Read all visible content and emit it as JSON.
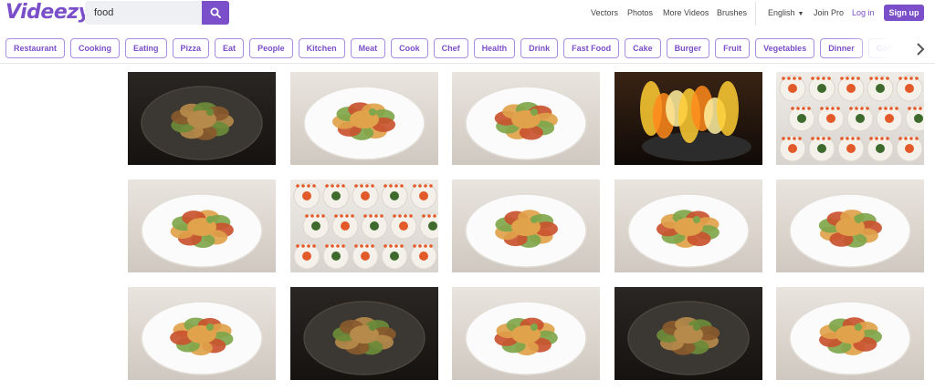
{
  "brand": {
    "logo": "Videezy",
    "accent": "#7a4fc9"
  },
  "search": {
    "value": "food",
    "icon": "search-icon"
  },
  "nav": {
    "vectors": "Vectors",
    "photos": "Photos",
    "more_videos": "More Videos",
    "brushes": "Brushes"
  },
  "account": {
    "language": "English",
    "join_pro": "Join Pro",
    "login": "Log in",
    "signup": "Sign up"
  },
  "tags": [
    "Restaurant",
    "Cooking",
    "Eating",
    "Pizza",
    "Eat",
    "People",
    "Kitchen",
    "Meat",
    "Cook",
    "Chef",
    "Health",
    "Drink",
    "Fast Food",
    "Cake",
    "Burger",
    "Fruit",
    "Vegetables",
    "Dinner",
    "Coffee"
  ],
  "tag_next_icon": "chevron-right-icon",
  "results": [
    {
      "subject": "noodles-wok",
      "scene": "dark"
    },
    {
      "subject": "vegetable-dip-platter",
      "scene": "plate"
    },
    {
      "subject": "grilled-shrimp-sauce",
      "scene": "plate"
    },
    {
      "subject": "flaming-wok",
      "scene": "fire"
    },
    {
      "subject": "sushi-rolls",
      "scene": "sushi"
    },
    {
      "subject": "spaghetti-plate",
      "scene": "plate"
    },
    {
      "subject": "sushi-platter",
      "scene": "sushi"
    },
    {
      "subject": "fried-rice-dome",
      "scene": "plate"
    },
    {
      "subject": "shrimp-noodles",
      "scene": "plate"
    },
    {
      "subject": "fried-shrimp-sauce",
      "scene": "plate"
    },
    {
      "subject": "grilled-fish-lemon",
      "scene": "plate"
    },
    {
      "subject": "pasta-herbs-dark",
      "scene": "dark"
    },
    {
      "subject": "pasta-salad",
      "scene": "plate"
    },
    {
      "subject": "steamed-mussels",
      "scene": "dark"
    },
    {
      "subject": "sashimi-herbs",
      "scene": "plate"
    }
  ]
}
